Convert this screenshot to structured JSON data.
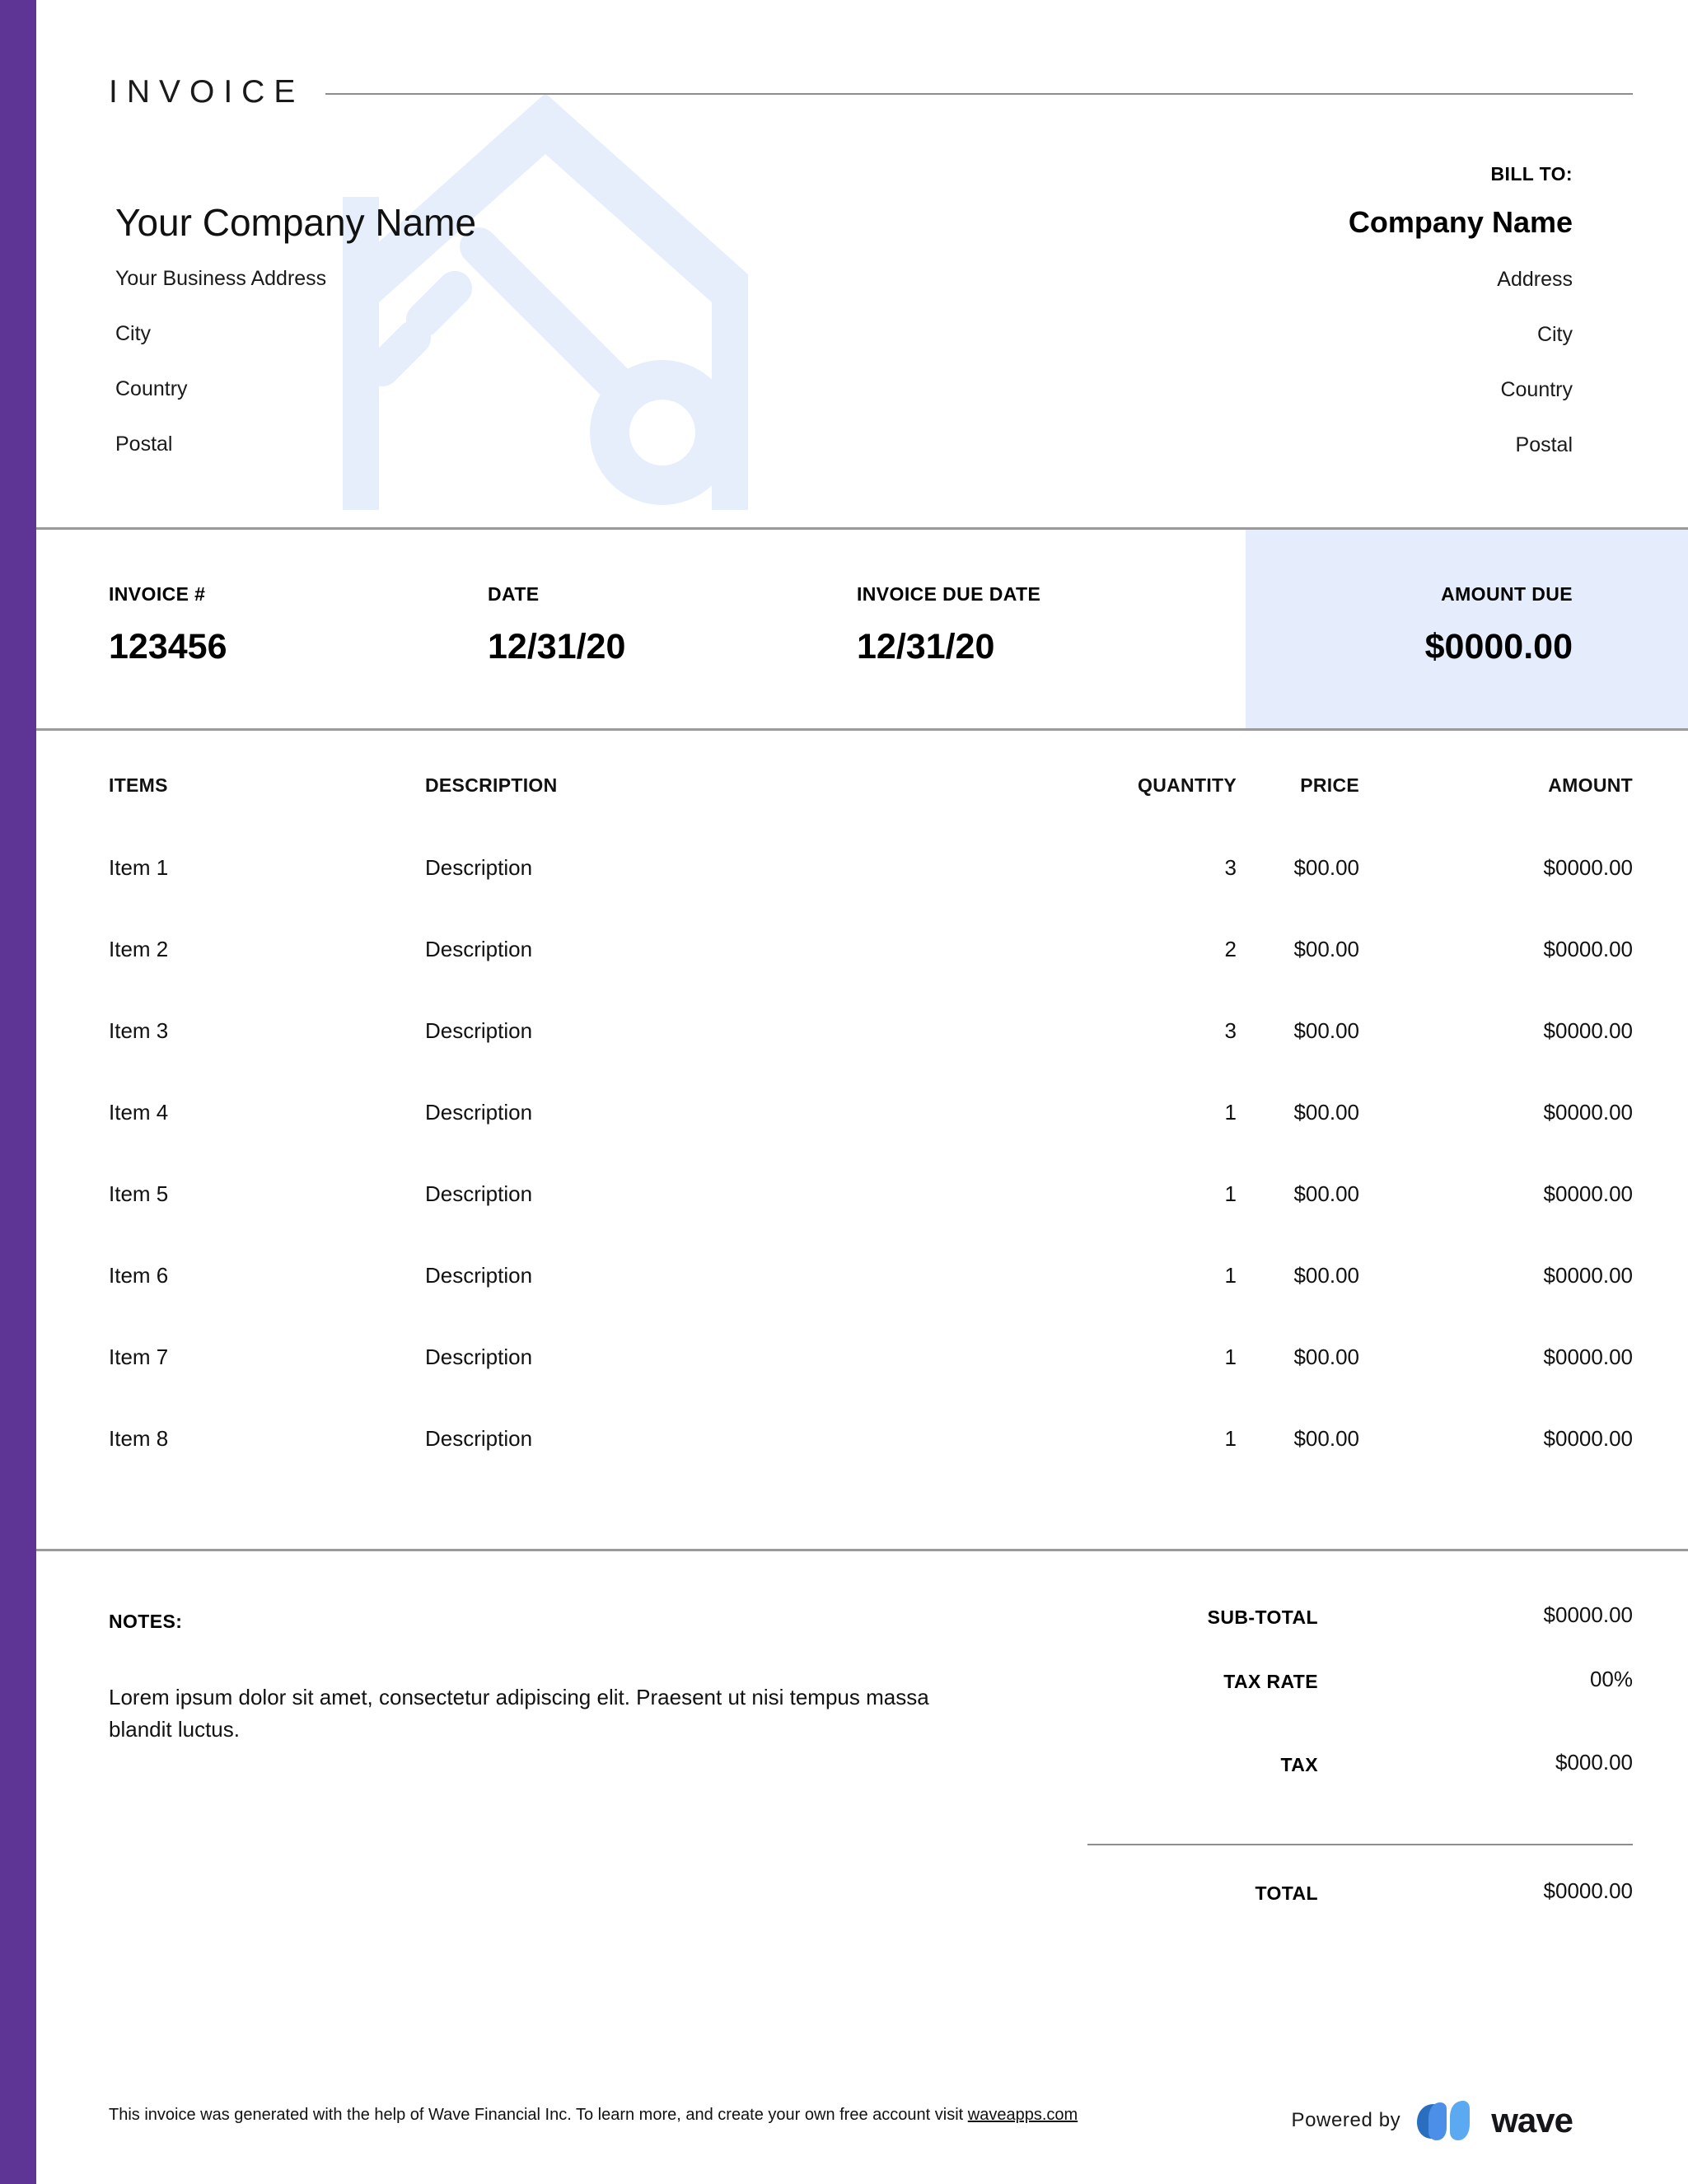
{
  "document": {
    "title": "INVOICE"
  },
  "from": {
    "company_name": "Your Company Name",
    "lines": [
      "Your Business Address",
      "City",
      "Country",
      "Postal"
    ]
  },
  "bill_to": {
    "label": "BILL TO:",
    "company_name": "Company Name",
    "lines": [
      "Address",
      "City",
      "Country",
      "Postal"
    ]
  },
  "meta": {
    "invoice_number_label": "INVOICE #",
    "invoice_number_value": "123456",
    "date_label": "DATE",
    "date_value": "12/31/20",
    "due_date_label": "INVOICE DUE DATE",
    "due_date_value": "12/31/20",
    "amount_due_label": "AMOUNT DUE",
    "amount_due_value": "$0000.00"
  },
  "items_table": {
    "headers": {
      "items": "ITEMS",
      "description": "DESCRIPTION",
      "quantity": "QUANTITY",
      "price": "PRICE",
      "amount": "AMOUNT"
    },
    "rows": [
      {
        "item": "Item 1",
        "description": "Description",
        "quantity": "3",
        "price": "$00.00",
        "amount": "$0000.00"
      },
      {
        "item": "Item 2",
        "description": "Description",
        "quantity": "2",
        "price": "$00.00",
        "amount": "$0000.00"
      },
      {
        "item": "Item 3",
        "description": "Description",
        "quantity": "3",
        "price": "$00.00",
        "amount": "$0000.00"
      },
      {
        "item": "Item 4",
        "description": "Description",
        "quantity": "1",
        "price": "$00.00",
        "amount": "$0000.00"
      },
      {
        "item": "Item 5",
        "description": "Description",
        "quantity": "1",
        "price": "$00.00",
        "amount": "$0000.00"
      },
      {
        "item": "Item 6",
        "description": "Description",
        "quantity": "1",
        "price": "$00.00",
        "amount": "$0000.00"
      },
      {
        "item": "Item 7",
        "description": "Description",
        "quantity": "1",
        "price": "$00.00",
        "amount": "$0000.00"
      },
      {
        "item": "Item 8",
        "description": "Description",
        "quantity": "1",
        "price": "$00.00",
        "amount": "$0000.00"
      }
    ]
  },
  "notes": {
    "label": "NOTES:",
    "text": "Lorem ipsum dolor sit amet, consectetur adipiscing elit. Praesent ut nisi tempus massa blandit luctus."
  },
  "totals": {
    "subtotal_label": "SUB-TOTAL",
    "subtotal_value": "$0000.00",
    "tax_rate_label": "TAX RATE",
    "tax_rate_value": "00%",
    "tax_label": "TAX",
    "tax_value": "$000.00",
    "total_label": "TOTAL",
    "total_value": "$0000.00"
  },
  "footer": {
    "disclaimer_prefix": "This invoice was generated with the help of Wave Financial Inc. To learn more, and create your own free account visit ",
    "link_text": "waveapps.com",
    "powered_by_label": "Powered by",
    "brand_name": "wave"
  },
  "colors": {
    "accent_purple": "#5E3595",
    "amount_due_panel": "#E5ECFB",
    "watermark_blue": "#E6EDFB",
    "rule_gray": "#9A9A9A",
    "wave_logo_dark": "#2A6EC0",
    "wave_logo_light": "#5BA9F0"
  },
  "icons": {
    "watermark": "house-key-icon",
    "brand": "wave-logo-icon"
  }
}
